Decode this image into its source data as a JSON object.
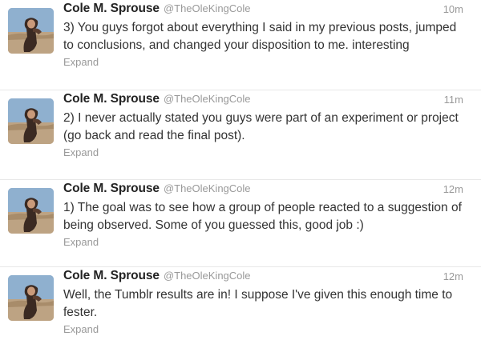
{
  "tweets": [
    {
      "fullname": "Cole M. Sprouse",
      "username": "@TheOleKingCole",
      "timestamp": "10m",
      "text": "3) You guys forgot about everything I said in my previous posts, jumped to conclusions, and changed your disposition to me. interesting",
      "expand": "Expand"
    },
    {
      "fullname": "Cole M. Sprouse",
      "username": "@TheOleKingCole",
      "timestamp": "11m",
      "text": "2) I never actually stated you guys were part of an experiment or project (go back and read the final post).",
      "expand": "Expand"
    },
    {
      "fullname": "Cole M. Sprouse",
      "username": "@TheOleKingCole",
      "timestamp": "12m",
      "text": "1) The goal was to see how a group of people reacted to a suggestion of being observed. Some of you guessed this, good job :)",
      "expand": "Expand"
    },
    {
      "fullname": "Cole M. Sprouse",
      "username": "@TheOleKingCole",
      "timestamp": "12m",
      "text": "Well, the Tumblr results are in! I suppose I've given this enough time to fester.",
      "expand": "Expand"
    }
  ]
}
